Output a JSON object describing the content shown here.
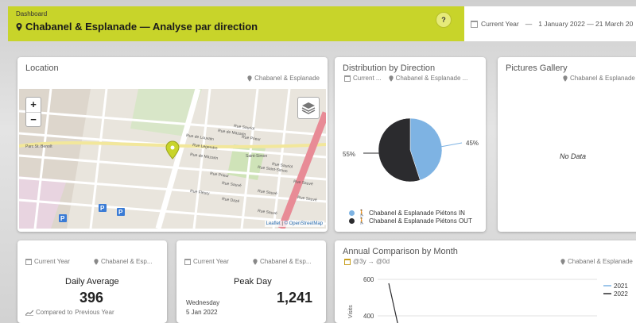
{
  "header": {
    "breadcrumb": "Dashboard",
    "title": "Chabanel & Esplanade — Analyse par direction",
    "help": "?",
    "date_range_label": "Current Year",
    "date_separator": "—",
    "date_range": "1 January 2022 — 21 March 20"
  },
  "location_card": {
    "title": "Location",
    "site": "Chabanel & Esplanade",
    "zoom_in": "+",
    "zoom_out": "−",
    "attribution_leaflet": "Leaflet",
    "attribution_sep": "|",
    "attribution_osm": "© OpenStreetMap",
    "street_labels": [
      "Rue de Louvain",
      "Rue Legendre",
      "Rue de Mazarin",
      "Rue de Mazarin",
      "Rue Sauriol",
      "Rue Prieur",
      "Rue Prieur",
      "Rue Saint-Simon",
      "Rue Sauvé",
      "Rue Fleury",
      "Rue Sauvé",
      "Saint-Simon",
      "Rue Sauriol",
      "Rue Dazé",
      "Rue Sauvé",
      "Parc St. Benoît",
      "Rue Sauvé",
      "Rue Sauvé"
    ]
  },
  "distribution_card": {
    "title": "Distribution by Direction",
    "period": "Current ...",
    "site": "Chabanel & Esplanade ...",
    "label_left": "55%",
    "label_right": "45%",
    "legend": [
      {
        "name": "Chabanel & Esplanade Piétons IN",
        "color": "#7eb3e3"
      },
      {
        "name": "Chabanel & Esplanade Piétons OUT",
        "color": "#2b2b2e"
      }
    ]
  },
  "chart_data": {
    "type": "pie",
    "categories": [
      "Chabanel & Esplanade Piétons IN",
      "Chabanel & Esplanade Piétons OUT"
    ],
    "values": [
      45,
      55
    ],
    "colors": [
      "#7eb3e3",
      "#2b2b2e"
    ]
  },
  "gallery_card": {
    "title": "Pictures Gallery",
    "site": "Chabanel & Esplanade",
    "empty": "No Data"
  },
  "daily_avg_card": {
    "period": "Current Year",
    "site": "Chabanel & Esp...",
    "label": "Daily Average",
    "value": "396",
    "footer_prefix": "Compared to",
    "footer_period": "Previous Year"
  },
  "peak_day_card": {
    "period": "Current Year",
    "site": "Chabanel & Esp...",
    "label": "Peak Day",
    "weekday": "Wednesday",
    "date": "5 Jan 2022",
    "value": "1,241"
  },
  "annual_card": {
    "title": "Annual Comparison by Month",
    "range": "@3y → @0d",
    "site": "Chabanel & Esplanade",
    "y_ticks": [
      "600",
      "400"
    ],
    "y_axis_label": "Visits",
    "legend": [
      {
        "name": "2021",
        "color": "#7eb3e3"
      },
      {
        "name": "2022",
        "color": "#2b2b2e"
      }
    ]
  }
}
